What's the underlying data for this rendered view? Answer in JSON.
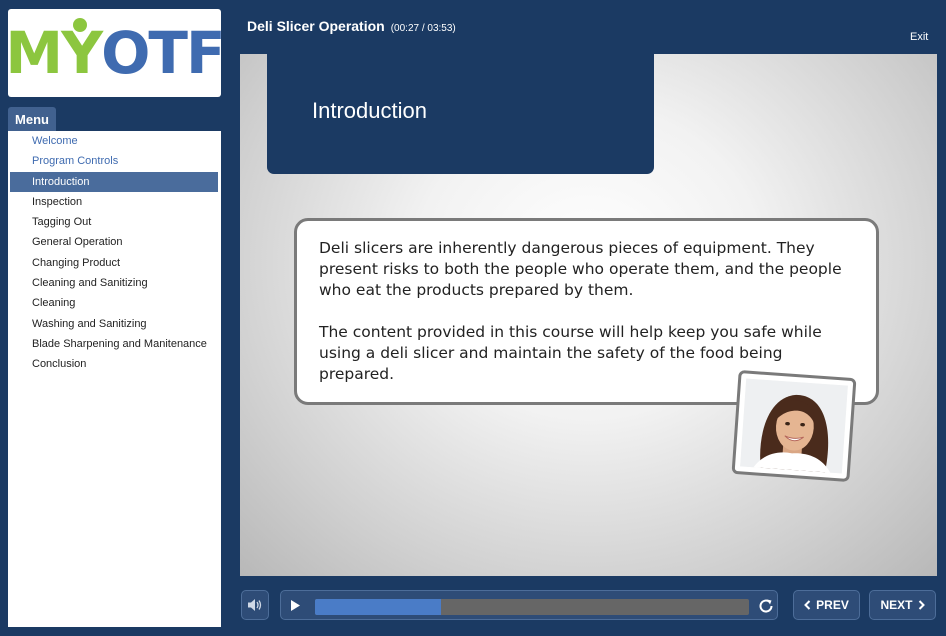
{
  "logo": {
    "m": "M",
    "y": "Y",
    "rest": "OTF"
  },
  "menu": {
    "tab_label": "Menu",
    "items": [
      {
        "label": "Welcome",
        "state": "visited"
      },
      {
        "label": "Program Controls",
        "state": "visited"
      },
      {
        "label": "Introduction",
        "state": "active"
      },
      {
        "label": "Inspection",
        "state": "normal"
      },
      {
        "label": "Tagging Out",
        "state": "normal"
      },
      {
        "label": "General Operation",
        "state": "normal"
      },
      {
        "label": "Changing Product",
        "state": "normal"
      },
      {
        "label": "Cleaning and Sanitizing",
        "state": "normal"
      },
      {
        "label": "Cleaning",
        "state": "normal"
      },
      {
        "label": "Washing and Sanitizing",
        "state": "normal"
      },
      {
        "label": "Blade Sharpening and Manitenance",
        "state": "normal"
      },
      {
        "label": "Conclusion",
        "state": "normal"
      }
    ]
  },
  "header": {
    "title": "Deli Slicer Operation",
    "time": "(00:27 / 03:53)",
    "exit_label": "Exit"
  },
  "slide": {
    "heading": "Introduction",
    "paragraph1": "Deli slicers are inherently dangerous pieces of equipment. They present risks to both the people who operate them, and the people who eat the products prepared by them.",
    "paragraph2": "The content provided in this course will help keep you safe while using a deli slicer and maintain the safety of the food being prepared."
  },
  "controls": {
    "progress": 0.29,
    "prev_label": "PREV",
    "next_label": "NEXT",
    "volume_icon": "speaker-icon",
    "play_icon": "play-icon",
    "replay_icon": "replay-icon"
  },
  "colors": {
    "frame": "#1b3a63",
    "accent": "#4a7cc7",
    "logo_green": "#8cc63f",
    "logo_blue": "#3f6bb0",
    "menu_active": "#4a6c9c"
  }
}
